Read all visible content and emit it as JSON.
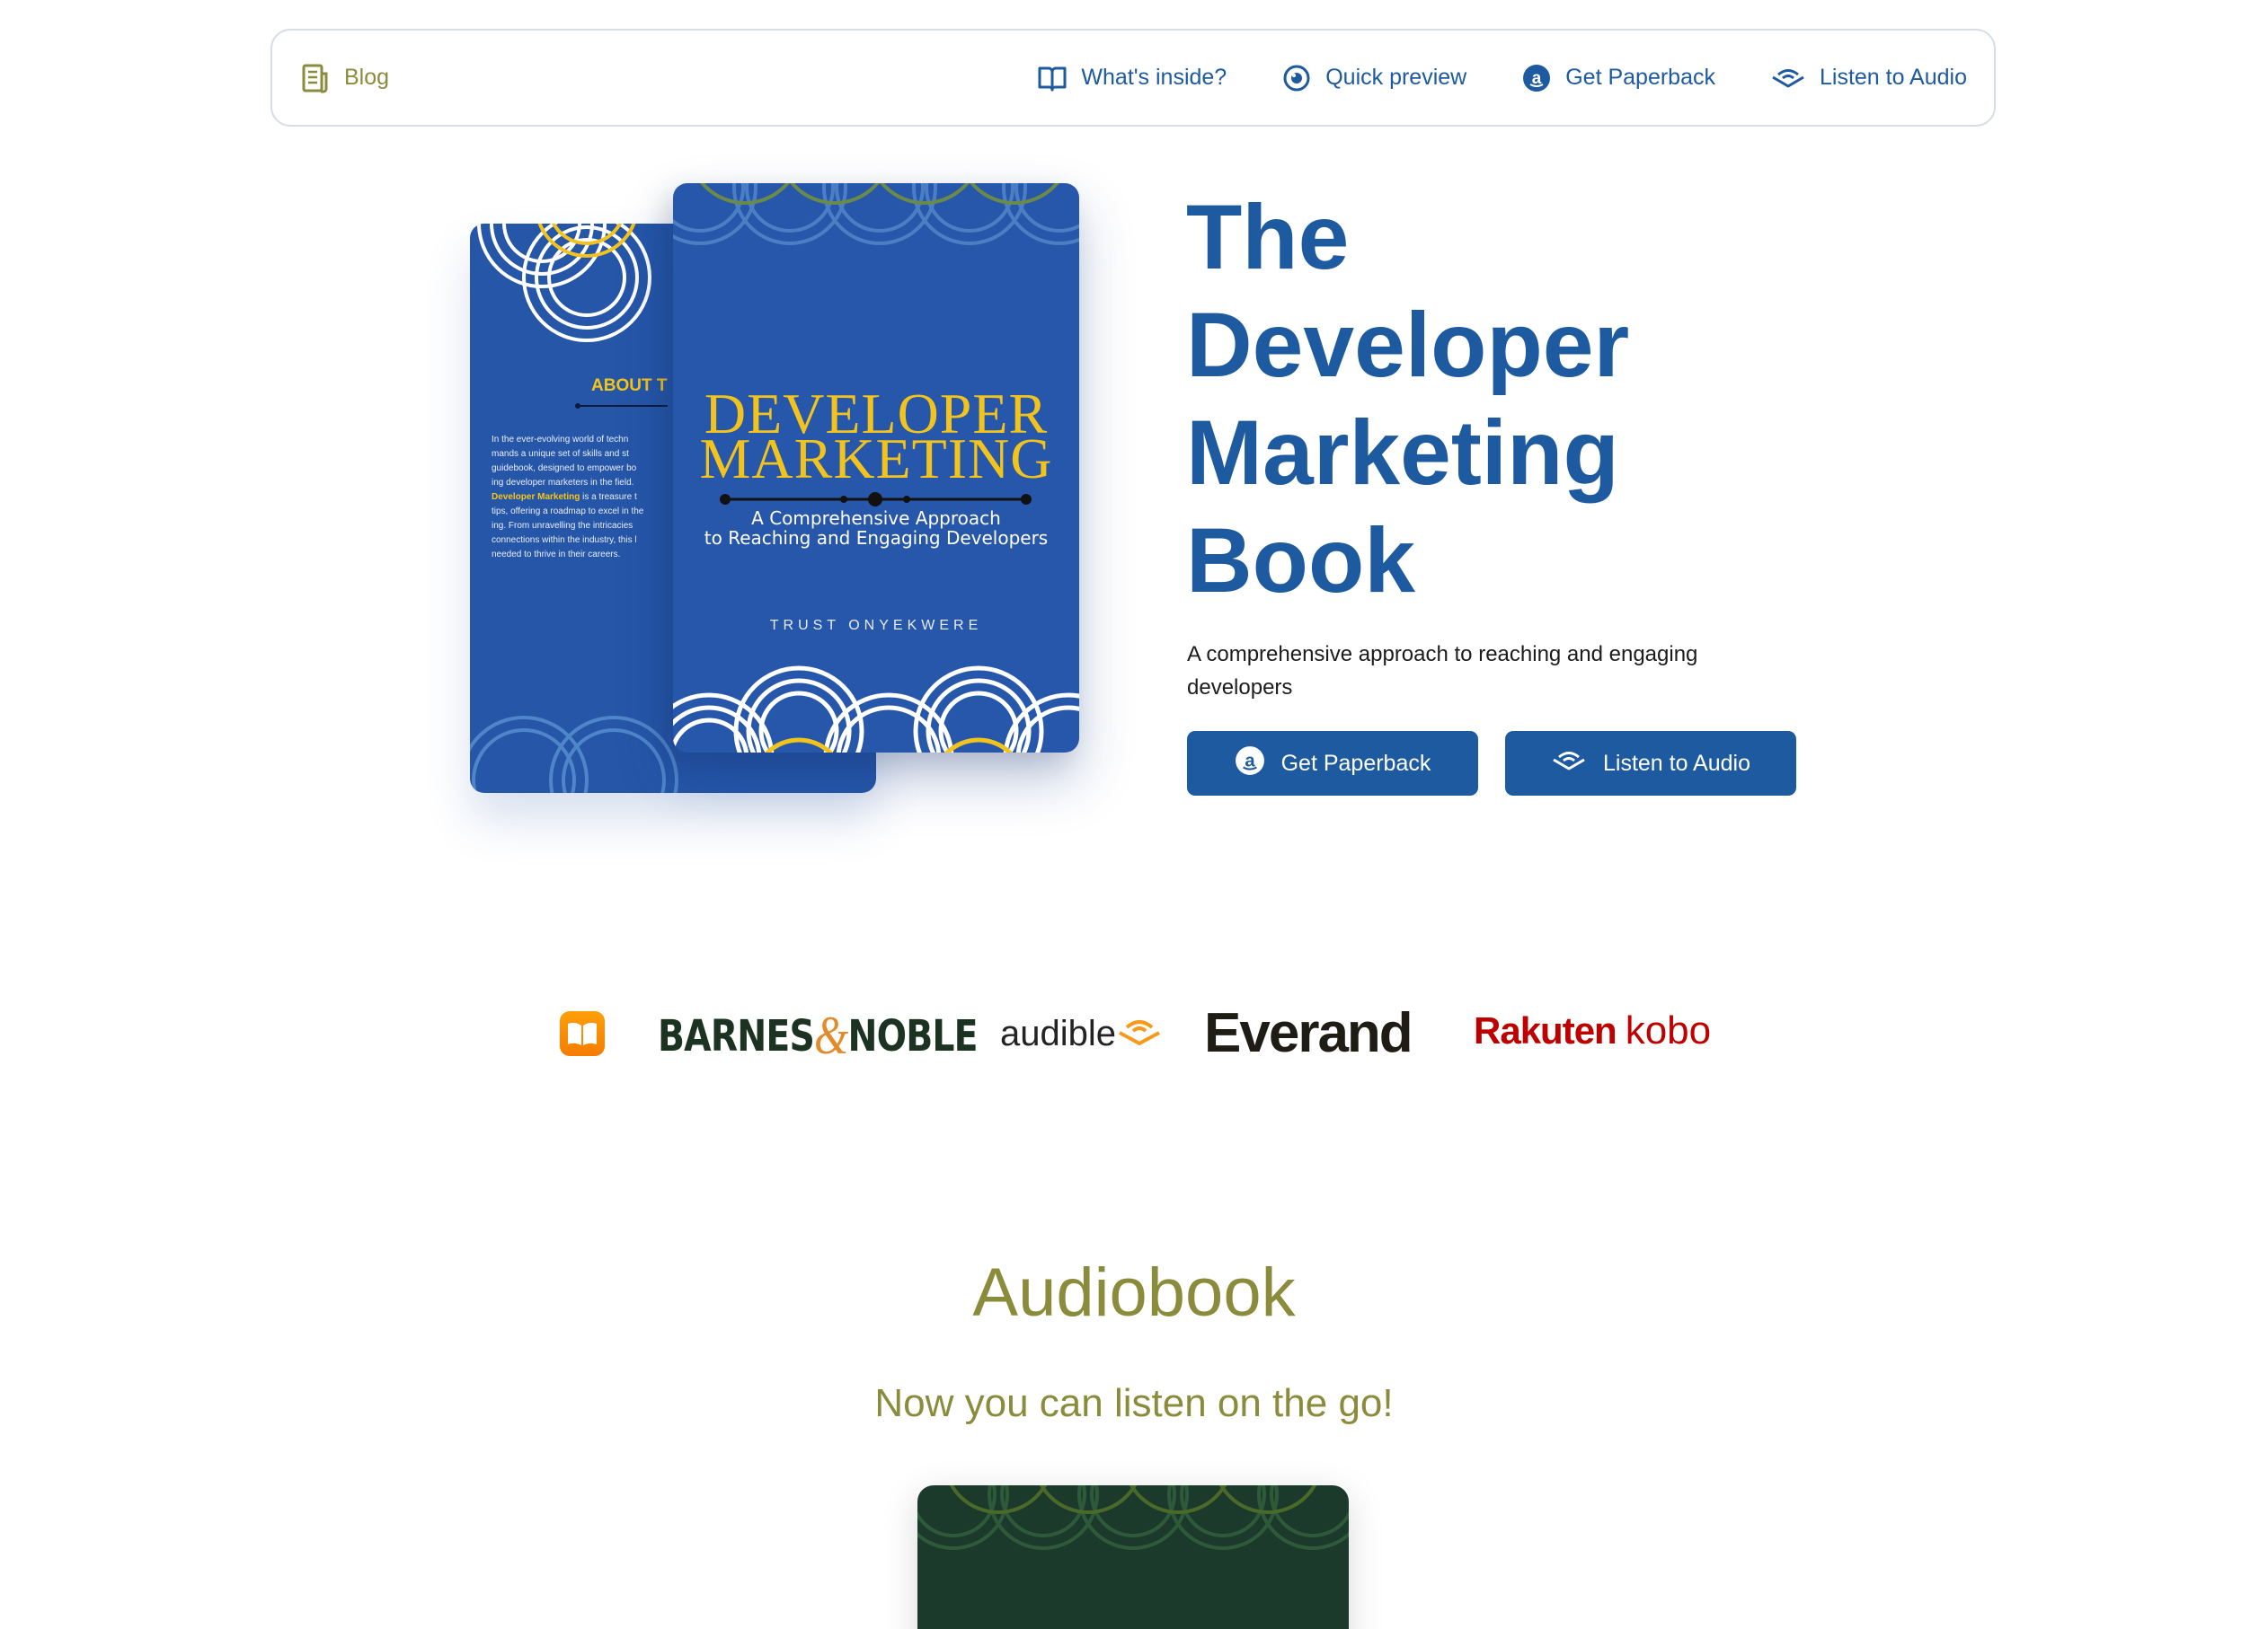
{
  "nav": {
    "blog_label": "Blog",
    "items": [
      {
        "label": "What's inside?",
        "icon": "book-open-icon"
      },
      {
        "label": "Quick preview",
        "icon": "eye-icon"
      },
      {
        "label": "Get Paperback",
        "icon": "amazon-icon"
      },
      {
        "label": "Listen to Audio",
        "icon": "audible-icon"
      }
    ]
  },
  "hero": {
    "title_lines": [
      "The",
      "Developer",
      "Marketing",
      "Book"
    ],
    "description": "A comprehensive approach to reaching and engaging developers",
    "btn_paperback": "Get Paperback",
    "btn_audio": "Listen to Audio"
  },
  "book_cover": {
    "title_line1": "DEVELOPER",
    "title_line2": "MARKETING",
    "subtitle_line1": "A Comprehensive Approach",
    "subtitle_line2": "to Reaching and Engaging Developers",
    "author": "TRUST ONYEKWERE",
    "back_heading": "ABOUT T",
    "back_para1": "In the ever-evolving world of techn\nmands a unique set of skills and st\nguidebook, designed to empower bo\ning developer marketers in the field.",
    "back_highlight": "Developer Marketing",
    "back_para2": " is a treasure t\ntips, offering a roadmap to excel in the\ning. From unravelling the intricacies\nconnections within the industry, this l\nneeded to thrive in their careers."
  },
  "logos": {
    "apple_books": "apple-books-icon",
    "barnes_a": "BARNES",
    "barnes_amp": "&",
    "barnes_b": "NOBLE",
    "audible": "audible",
    "everand": "Everand",
    "rakuten": "Rakuten",
    "kobo": "kobo"
  },
  "audiobook": {
    "title": "Audiobook",
    "subtitle": "Now you can listen on the go!"
  },
  "colors": {
    "primary": "#1e5aa0",
    "olive": "#8a8c3c",
    "cover_blue": "#2757aa",
    "cover_gold": "#f2c31d",
    "audio_cover": "#1b3a2c"
  }
}
